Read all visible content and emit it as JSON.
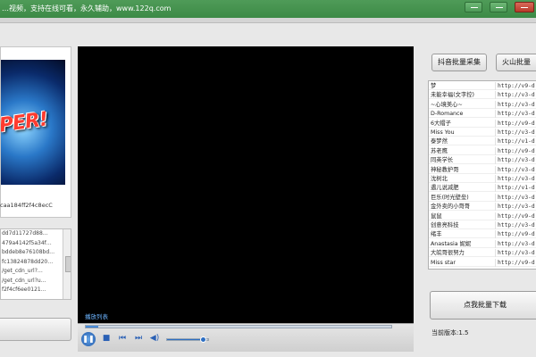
{
  "window": {
    "title": "…视频，支持在线可看，永久辅助，www.122q.com"
  },
  "left": {
    "thumbnail_logo": "PER!",
    "video_hash": "caa184ff2f4c8ecC",
    "url_list": [
      "dd7d11727d88…",
      "479a4142f5a34f…",
      "bddeb8e76108bd…",
      "fc13824878dd20…",
      "/get_cdn_url?…",
      "/get_cdn_url?u…",
      "f2f4cf6ee0121…"
    ]
  },
  "player": {
    "label": "播放列表",
    "progress": 0.04,
    "volume": 0.9,
    "icons": [
      "pause-icon",
      "stop-icon",
      "prev-icon",
      "next-icon",
      "volume-icon"
    ]
  },
  "right": {
    "douyin_button": "抖音批量采集",
    "huoshan_button": "火山批量",
    "rows": [
      {
        "name": "梦",
        "url": "http://v9-d"
      },
      {
        "name": "未能幸福(文字控)",
        "url": "http://v3-d"
      },
      {
        "name": "   ~心境美心~",
        "url": "http://v3-d"
      },
      {
        "name": "D-Romance",
        "url": "http://v3-d"
      },
      {
        "name": "6大帽子",
        "url": "http://v9-d"
      },
      {
        "name": "  Miss You",
        "url": "http://v3-d"
      },
      {
        "name": "泰梦然",
        "url": "http://v1-d"
      },
      {
        "name": "苏老鹰",
        "url": "http://v9-d"
      },
      {
        "name": "同英学长",
        "url": "http://v3-d"
      },
      {
        "name": "神秘教护哥",
        "url": "http://v3-d"
      },
      {
        "name": "沈树北",
        "url": "http://v3-d"
      },
      {
        "name": "遇儿说减肥",
        "url": "http://v1-d"
      },
      {
        "name": "巨乐(时光壁垒)",
        "url": "http://v3-d"
      },
      {
        "name": "金外卖的小哥哥",
        "url": "http://v3-d"
      },
      {
        "name": "鼠鼠",
        "url": "http://v9-d"
      },
      {
        "name": "创意亮科技",
        "url": "http://v3-d"
      },
      {
        "name": "绪丰",
        "url": "http://v9-d"
      },
      {
        "name": "Anastasia 妮妮",
        "url": "http://v3-d"
      },
      {
        "name": "大皖哥很努力",
        "url": "http://v3-d"
      },
      {
        "name": "Miss star",
        "url": "http://v9-d"
      }
    ],
    "batch_download_button": "点我批量下载",
    "version_text": "当前版本:1.5"
  }
}
